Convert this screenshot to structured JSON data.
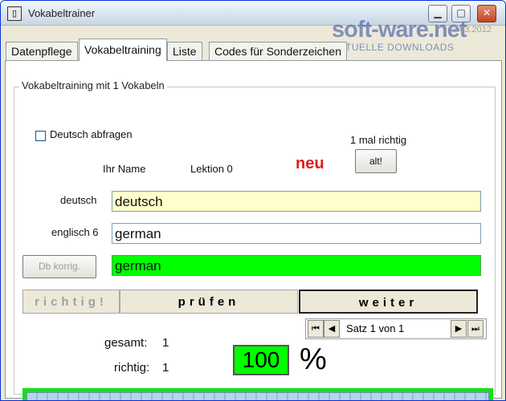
{
  "window": {
    "title": "Vokabeltrainer",
    "icon": "book-icon",
    "controls": {
      "minimize": "▁",
      "maximize": "□",
      "close": "✕"
    }
  },
  "watermark": {
    "main": "soft-ware.net",
    "date": "2.03.2012",
    "sub": "AKTUELLE DOWNLOADS"
  },
  "tabs": [
    {
      "label": "Datenpflege",
      "active": false
    },
    {
      "label": "Vokabeltraining",
      "active": true
    },
    {
      "label": "Liste",
      "active": false
    },
    {
      "label": "Codes für Sonderzeichen",
      "active": false
    }
  ],
  "group": {
    "title": "Vokabeltraining mit  1 Vokabeln"
  },
  "options": {
    "deutsch_abfragen_label": "Deutsch abfragen",
    "deutsch_abfragen_checked": false
  },
  "stats_top": {
    "mal_richtig": "1  mal richtig",
    "alt_button": "alt!"
  },
  "info": {
    "name_label": "Ihr Name",
    "lektion_label": "Lektion  0",
    "status": "neu"
  },
  "fields": {
    "deutsch_label": "deutsch",
    "deutsch_value": "deutsch",
    "englisch_label": "englisch 6",
    "englisch_value": "german",
    "db_korrig_button": "Db korrig.",
    "result_value": "german"
  },
  "buttons": {
    "richtig": "richtig!",
    "pruefen": "prüfen",
    "weiter": "weiter"
  },
  "navigator": {
    "first": "⏮",
    "prev": "◀",
    "text": "Satz  1 von  1",
    "next": "▶",
    "last": "⏭"
  },
  "summary": {
    "gesamt_label": "gesamt:",
    "gesamt_value": "1",
    "richtig_label": "richtig:",
    "richtig_value": "1",
    "percent": "100",
    "percent_sign": "%"
  },
  "progress": {
    "fraction": 1.0
  },
  "colors": {
    "deutsch_field_bg": "#ffffcc",
    "result_field_bg": "#00ff00",
    "percent_bg": "#00ff00",
    "status_color": "#e01c1c"
  }
}
